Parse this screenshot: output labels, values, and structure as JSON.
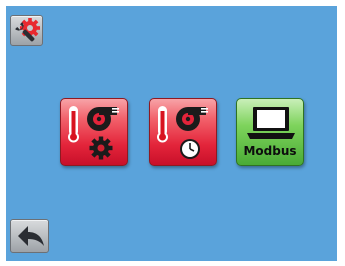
{
  "toolbar": {
    "settings_icon": "wrench-gear-icon",
    "back_icon": "back-arrow-icon"
  },
  "tiles": [
    {
      "icon": "fan-heater-settings-icon"
    },
    {
      "icon": "fan-heater-timer-icon"
    },
    {
      "icon": "computer-icon",
      "label": "Modbus"
    }
  ],
  "colors": {
    "screen_background": "#5aa3db",
    "tile_red": "#e3243a",
    "tile_green": "#4aab36"
  }
}
